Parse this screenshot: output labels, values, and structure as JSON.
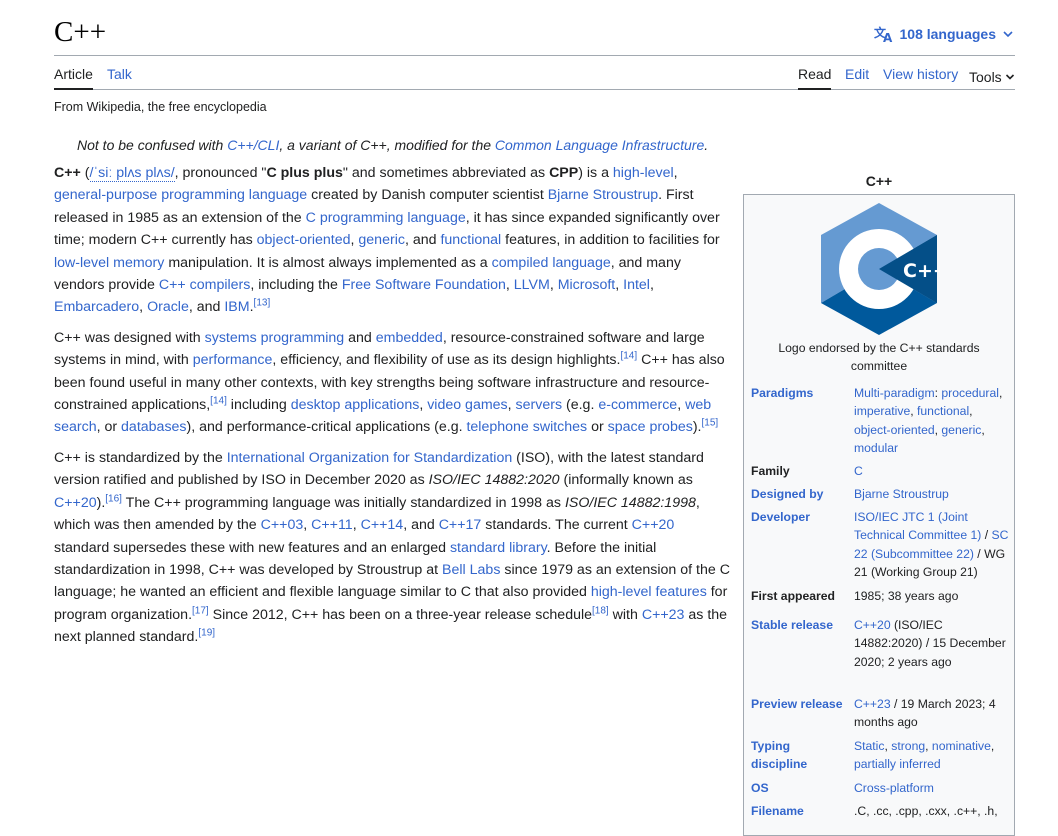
{
  "page": {
    "title": "C++",
    "languages_label": "108 languages",
    "tabs": {
      "article": "Article",
      "talk": "Talk",
      "read": "Read",
      "edit": "Edit",
      "history": "View history",
      "tools": "Tools"
    },
    "tagline": "From Wikipedia, the free encyclopedia"
  },
  "hatnote": {
    "p1": "Not to be confused with ",
    "l1": "C++/CLI",
    "p2": ", a variant of C++, modified for the ",
    "l2": "Common Language Infrastructure",
    "p3": "."
  },
  "article": {
    "para1": {
      "t0": "C++",
      "t1": " (",
      "ipa": "/ˈsiː plʌs plʌs/",
      "t2": ", pronounced \"",
      "b1": "C plus plus",
      "t3": "\" and sometimes abbreviated as ",
      "b2": "CPP",
      "t4": ") is a ",
      "l1": "high-level",
      "t5": ", ",
      "l2": "general-purpose programming language",
      "t6": " created by Danish computer scientist ",
      "l3": "Bjarne Stroustrup",
      "t7": ". First released in 1985 as an extension of the ",
      "l4": "C programming language",
      "t8": ", it has since expanded significantly over time; modern C++ currently has ",
      "l5": "object-oriented",
      "t9": ", ",
      "l6": "generic",
      "t10": ", and ",
      "l7": "functional",
      "t11": " features, in addition to facilities for ",
      "l8": "low-level memory",
      "t12": " manipulation. It is almost always implemented as a ",
      "l9": "compiled language",
      "t13": ", and many vendors provide ",
      "l10": "C++ compilers",
      "t14": ", including the ",
      "l11": "Free Software Foundation",
      "t15": ", ",
      "l12": "LLVM",
      "t16": ", ",
      "l13": "Microsoft",
      "t17": ", ",
      "l14": "Intel",
      "t18": ", ",
      "l15": "Embarcadero",
      "t19": ", ",
      "l16": "Oracle",
      "t20": ", and ",
      "l17": "IBM",
      "t21": ".",
      "r1": "[13]"
    },
    "para2": {
      "t0": "C++ was designed with ",
      "l1": "systems programming",
      "t1": " and ",
      "l2": "embedded",
      "t2": ", resource-constrained software and large systems in mind, with ",
      "l3": "performance",
      "t3": ", efficiency, and flexibility of use as its design highlights.",
      "r1": "[14]",
      "t4": " C++ has also been found useful in many other contexts, with key strengths being software infrastructure and resource-constrained applications,",
      "r2": "[14]",
      "t5": " including ",
      "l4": "desktop applications",
      "t6": ", ",
      "l5": "video games",
      "t7": ", ",
      "l6": "servers",
      "t8": " (e.g. ",
      "l7": "e-commerce",
      "t9": ", ",
      "l8": "web search",
      "t10": ", or ",
      "l9": "databases",
      "t11": "), and performance-critical applications (e.g. ",
      "l10": "telephone switches",
      "t12": " or ",
      "l11": "space probes",
      "t13": ").",
      "r3": "[15]"
    },
    "para3": {
      "t0": "C++ is standardized by the ",
      "l1": "International Organization for Standardization",
      "t1": " (ISO), with the latest standard version ratified and published by ISO in December 2020 as ",
      "i1": "ISO/IEC 14882:2020",
      "t2": " (informally known as ",
      "l2": "C++20",
      "t3": ").",
      "r1": "[16]",
      "t4": " The C++ programming language was initially standardized in 1998 as ",
      "i2": "ISO/IEC 14882:1998",
      "t5": ", which was then amended by the ",
      "l3": "C++03",
      "t6": ", ",
      "l4": "C++11",
      "t7": ", ",
      "l5": "C++14",
      "t8": ", and ",
      "l6": "C++17",
      "t9": " standards. The current ",
      "l7": "C++20",
      "t10": " standard supersedes these with new features and an enlarged ",
      "l8": "standard library",
      "t11": ". Before the initial standardization in 1998, C++ was developed by Stroustrup at ",
      "l9": "Bell Labs",
      "t12": " since 1979 as an extension of the C language; he wanted an efficient and flexible language similar to C that also provided ",
      "l10": "high-level features",
      "t13": " for program organization.",
      "r2": "[17]",
      "t14": " Since 2012, C++ has been on a three-year release schedule",
      "r3": "[18]",
      "t15": " with ",
      "l11": "C++23",
      "t16": " as the next planned standard.",
      "r4": "[19]"
    }
  },
  "infobox": {
    "title": "C++",
    "logo_text": "C++",
    "logo_caption": "Logo endorsed by the C++ standards committee",
    "paradigms": {
      "label": "Paradigms",
      "v1": "Multi-paradigm",
      "v2": ": ",
      "v3": "procedural",
      "v4": ", ",
      "v5": "imperative",
      "v6": ", ",
      "v7": "functional",
      "v8": ", ",
      "v9": "object-oriented",
      "v10": ", ",
      "v11": "generic",
      "v12": ", ",
      "v13": "modular"
    },
    "family": {
      "label": "Family",
      "value": "C"
    },
    "designed_by": {
      "label": "Designed by",
      "value": "Bjarne Stroustrup"
    },
    "developer": {
      "label": "Developer",
      "v1": "ISO/IEC JTC 1 (Joint Technical Committee 1)",
      "v2": " / ",
      "v3": "SC 22 (Subcommittee 22)",
      "v4": " / WG 21 (Working Group 21)"
    },
    "first_appeared": {
      "label": "First appeared",
      "value": "1985; 38 years ago"
    },
    "stable_release": {
      "label": "Stable release",
      "v1": "C++20",
      "v2": " (ISO/IEC 14882:2020) / 15 December 2020; 2 years ago"
    },
    "preview_release": {
      "label": "Preview release",
      "v1": "C++23",
      "v2": " / 19 March 2023; 4 months ago"
    },
    "typing": {
      "label": "Typing discipline",
      "v1": "Static",
      "v2": ", ",
      "v3": "strong",
      "v4": ", ",
      "v5": "nominative",
      "v6": ", ",
      "v7": "partially inferred"
    },
    "os": {
      "label": "OS",
      "value": "Cross-platform"
    },
    "filename": {
      "label": "Filename",
      "value": ".C, .cc, .cpp, .cxx, .c++, .h,"
    }
  }
}
